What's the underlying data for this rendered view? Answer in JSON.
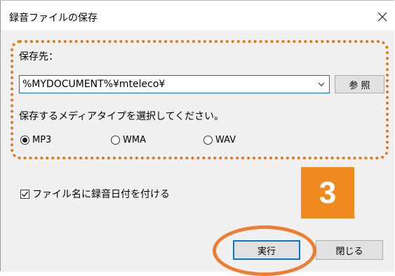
{
  "window": {
    "title": "録音ファイルの保存",
    "close_glyph": "✕"
  },
  "destination": {
    "label": "保存先：",
    "path_value": "%MYDOCUMENT%¥mteleco¥",
    "browse_label": "参 照"
  },
  "media_type": {
    "label": "保存するメディアタイプを選択してください。",
    "options": [
      {
        "label": "MP3",
        "selected": true
      },
      {
        "label": "WMA",
        "selected": false
      },
      {
        "label": "WAV",
        "selected": false
      }
    ]
  },
  "date_checkbox": {
    "label": "ファイル名に録音日付を付ける",
    "checked": true
  },
  "step_badge": "3",
  "buttons": {
    "run_label": "実行",
    "close_label": "閉じる"
  },
  "colors": {
    "accent_orange": "#ef8a1f",
    "dotted_border": "#e57618",
    "focus_blue": "#0078d7"
  }
}
